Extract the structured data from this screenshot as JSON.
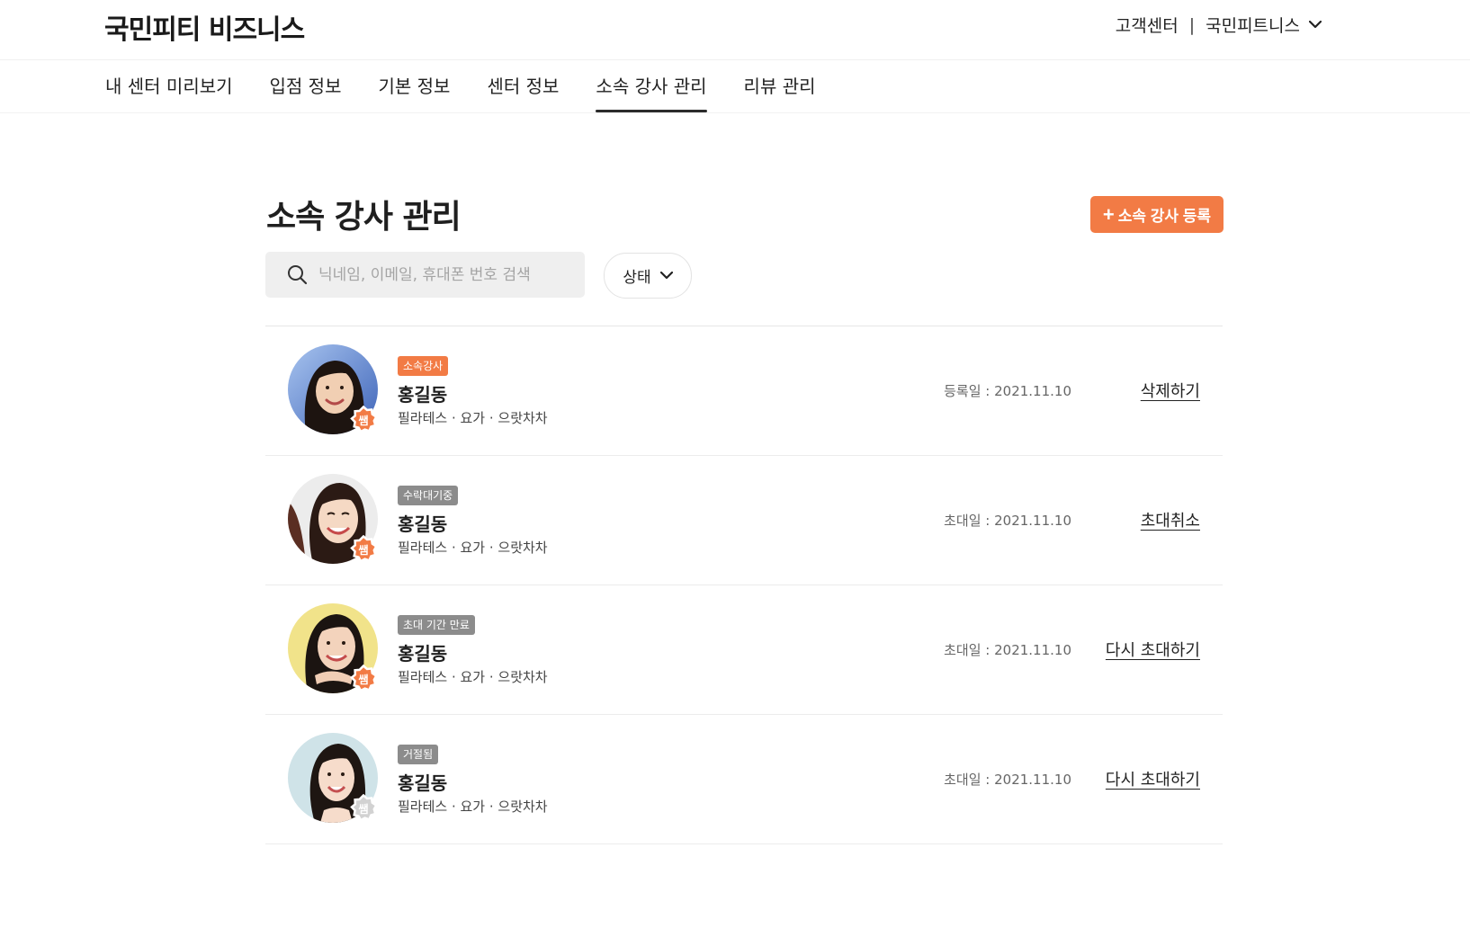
{
  "header": {
    "logo": "국민피티 비즈니스",
    "support_link": "고객센터",
    "separator": "|",
    "account_menu": "국민피트니스"
  },
  "nav": {
    "items": [
      {
        "label": "내 센터 미리보기"
      },
      {
        "label": "입점 정보"
      },
      {
        "label": "기본 정보"
      },
      {
        "label": "센터 정보"
      },
      {
        "label": "소속 강사 관리",
        "active": true
      },
      {
        "label": "리뷰 관리"
      }
    ]
  },
  "page": {
    "title": "소속 강사 관리",
    "add_button": {
      "icon": "+",
      "label": "소속 강사 등록"
    },
    "search": {
      "placeholder": "닉네임, 이메일, 휴대폰 번호 검색",
      "value": ""
    },
    "status_filter": "상태"
  },
  "colors": {
    "accent": "#f27b45",
    "badge_gray": "#8c8c8c",
    "ssam_inactive": "#d2d2d2"
  },
  "instructors": [
    {
      "badge": "소속강사",
      "badge_color": "orange",
      "name": "홍길동",
      "tags": "필라테스 · 요가 · 으랏차차",
      "date": "등록일 : 2021.11.10",
      "action": "삭제하기",
      "ssam_label": "쌤",
      "ssam_active": true
    },
    {
      "badge": "수락대기중",
      "badge_color": "gray",
      "name": "홍길동",
      "tags": "필라테스 · 요가 · 으랏차차",
      "date": "초대일 : 2021.11.10",
      "action": "초대취소",
      "ssam_label": "쌤",
      "ssam_active": true
    },
    {
      "badge": "초대 기간 만료",
      "badge_color": "gray",
      "name": "홍길동",
      "tags": "필라테스 · 요가 · 으랏차차",
      "date": "초대일 : 2021.11.10",
      "action": "다시 초대하기",
      "ssam_label": "쌤",
      "ssam_active": true
    },
    {
      "badge": "거절됨",
      "badge_color": "gray",
      "name": "홍길동",
      "tags": "필라테스 · 요가 · 으랏차차",
      "date": "초대일 : 2021.11.10",
      "action": "다시 초대하기",
      "ssam_label": "쌤",
      "ssam_active": false
    }
  ]
}
